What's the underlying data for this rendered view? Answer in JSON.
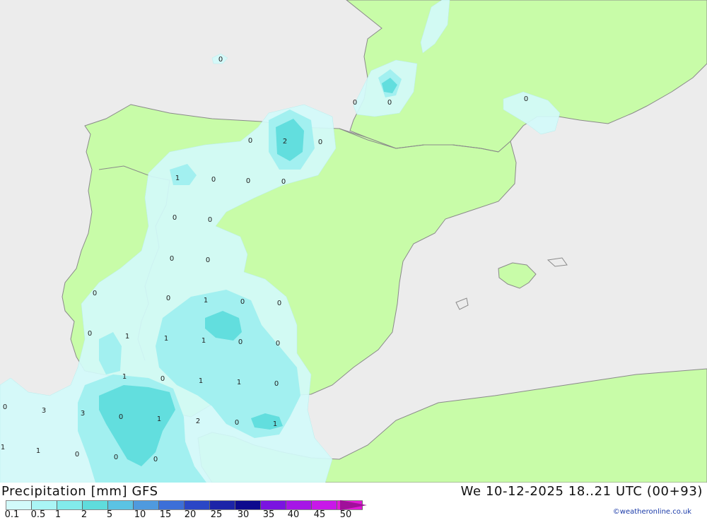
{
  "header": {
    "title_left": "Precipitation [mm] GFS",
    "title_right": "We 10-12-2025 18..21 UTC (00+93)"
  },
  "legend": {
    "ticks": [
      "0.1",
      "0.5",
      "1",
      "2",
      "5",
      "10",
      "15",
      "20",
      "25",
      "30",
      "35",
      "40",
      "45",
      "50"
    ],
    "colors": [
      "#d2fafa",
      "#aaf5f5",
      "#82ebeb",
      "#5fdcdc",
      "#5bc3e3",
      "#4f9ade",
      "#3c6fd8",
      "#2a46c6",
      "#1c24a8",
      "#0d0a8e",
      "#7a14e0",
      "#a616e6",
      "#c818e8",
      "#e01ad6"
    ]
  },
  "credit": "©weatheronline.co.uk",
  "map": {
    "colors": {
      "sea": "#ececec",
      "land": "#c8fca8",
      "border": "#8a8a8a",
      "precip_light": "#d2fafa",
      "precip_mid": "#82ebeb",
      "precip_heavy": "#5fdcdc"
    },
    "precip_labels": [
      "0",
      "0",
      "0",
      "0",
      "0",
      "2",
      "0",
      "1",
      "0",
      "0",
      "0",
      "0",
      "0",
      "0",
      "0",
      "0",
      "0",
      "1",
      "0",
      "0",
      "0",
      "1",
      "1",
      "1",
      "0",
      "0",
      "1",
      "0",
      "1",
      "1",
      "0",
      "0",
      "3",
      "3",
      "0",
      "1",
      "2",
      "0",
      "1",
      "1",
      "1",
      "0",
      "0",
      "0"
    ]
  }
}
